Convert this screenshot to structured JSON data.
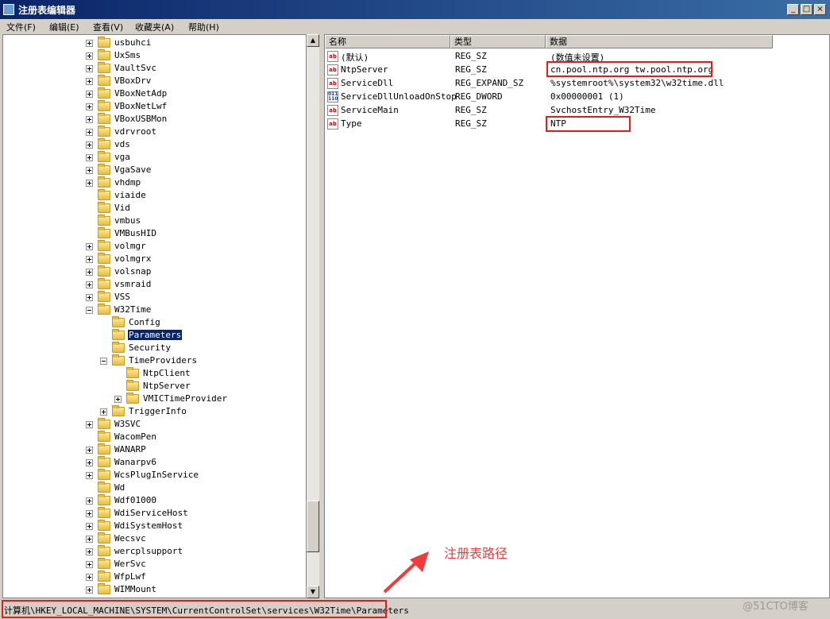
{
  "window": {
    "title": "注册表编辑器",
    "minimize": "_",
    "maximize": "□",
    "close": "×"
  },
  "menu": [
    "文件(F)",
    "编辑(E)",
    "查看(V)",
    "收藏夹(A)",
    "帮助(H)"
  ],
  "tree": {
    "nodes": [
      {
        "label": "usbuhci",
        "depth": 0,
        "expandable": true
      },
      {
        "label": "UxSms",
        "depth": 0,
        "expandable": true
      },
      {
        "label": "VaultSvc",
        "depth": 0,
        "expandable": true
      },
      {
        "label": "VBoxDrv",
        "depth": 0,
        "expandable": true
      },
      {
        "label": "VBoxNetAdp",
        "depth": 0,
        "expandable": true
      },
      {
        "label": "VBoxNetLwf",
        "depth": 0,
        "expandable": true
      },
      {
        "label": "VBoxUSBMon",
        "depth": 0,
        "expandable": true
      },
      {
        "label": "vdrvroot",
        "depth": 0,
        "expandable": true
      },
      {
        "label": "vds",
        "depth": 0,
        "expandable": true
      },
      {
        "label": "vga",
        "depth": 0,
        "expandable": true
      },
      {
        "label": "VgaSave",
        "depth": 0,
        "expandable": true
      },
      {
        "label": "vhdmp",
        "depth": 0,
        "expandable": true
      },
      {
        "label": "viaide",
        "depth": 0,
        "expandable": false
      },
      {
        "label": "Vid",
        "depth": 0,
        "expandable": false
      },
      {
        "label": "vmbus",
        "depth": 0,
        "expandable": false
      },
      {
        "label": "VMBusHID",
        "depth": 0,
        "expandable": false
      },
      {
        "label": "volmgr",
        "depth": 0,
        "expandable": true
      },
      {
        "label": "volmgrx",
        "depth": 0,
        "expandable": true
      },
      {
        "label": "volsnap",
        "depth": 0,
        "expandable": true
      },
      {
        "label": "vsmraid",
        "depth": 0,
        "expandable": true
      },
      {
        "label": "VSS",
        "depth": 0,
        "expandable": true
      },
      {
        "label": "W32Time",
        "depth": 0,
        "expandable": true,
        "expanded": true
      },
      {
        "label": "Config",
        "depth": 1,
        "expandable": false
      },
      {
        "label": "Parameters",
        "depth": 1,
        "expandable": false,
        "selected": true
      },
      {
        "label": "Security",
        "depth": 1,
        "expandable": false
      },
      {
        "label": "TimeProviders",
        "depth": 1,
        "expandable": true,
        "expanded": true
      },
      {
        "label": "NtpClient",
        "depth": 2,
        "expandable": false
      },
      {
        "label": "NtpServer",
        "depth": 2,
        "expandable": false
      },
      {
        "label": "VMICTimeProvider",
        "depth": 2,
        "expandable": true
      },
      {
        "label": "TriggerInfo",
        "depth": 1,
        "expandable": true
      },
      {
        "label": "W3SVC",
        "depth": 0,
        "expandable": true
      },
      {
        "label": "WacomPen",
        "depth": 0,
        "expandable": false
      },
      {
        "label": "WANARP",
        "depth": 0,
        "expandable": true
      },
      {
        "label": "Wanarpv6",
        "depth": 0,
        "expandable": true
      },
      {
        "label": "WcsPlugInService",
        "depth": 0,
        "expandable": true
      },
      {
        "label": "Wd",
        "depth": 0,
        "expandable": false
      },
      {
        "label": "Wdf01000",
        "depth": 0,
        "expandable": true
      },
      {
        "label": "WdiServiceHost",
        "depth": 0,
        "expandable": true
      },
      {
        "label": "WdiSystemHost",
        "depth": 0,
        "expandable": true
      },
      {
        "label": "Wecsvc",
        "depth": 0,
        "expandable": true
      },
      {
        "label": "wercplsupport",
        "depth": 0,
        "expandable": true
      },
      {
        "label": "WerSvc",
        "depth": 0,
        "expandable": true
      },
      {
        "label": "WfpLwf",
        "depth": 0,
        "expandable": true
      },
      {
        "label": "WIMMount",
        "depth": 0,
        "expandable": true
      }
    ]
  },
  "values": {
    "columns": [
      "名称",
      "类型",
      "数据"
    ],
    "rows": [
      {
        "name": "(默认)",
        "type": "REG_SZ",
        "data": "(数值未设置)",
        "icon": "string-value-icon"
      },
      {
        "name": "NtpServer",
        "type": "REG_SZ",
        "data": "cn.pool.ntp.org tw.pool.ntp.org",
        "icon": "string-value-icon",
        "highlight": true
      },
      {
        "name": "ServiceDll",
        "type": "REG_EXPAND_SZ",
        "data": "%systemroot%\\system32\\w32time.dll",
        "icon": "string-value-icon"
      },
      {
        "name": "ServiceDllUnloadOnStop",
        "type": "REG_DWORD",
        "data": "0x00000001 (1)",
        "icon": "dword-value-icon"
      },
      {
        "name": "ServiceMain",
        "type": "REG_SZ",
        "data": "SvchostEntry_W32Time",
        "icon": "string-value-icon"
      },
      {
        "name": "Type",
        "type": "REG_SZ",
        "data": "NTP",
        "icon": "string-value-icon",
        "highlight": true
      }
    ]
  },
  "status": {
    "path": "计算机\\HKEY_LOCAL_MACHINE\\SYSTEM\\CurrentControlSet\\services\\W32Time\\Parameters"
  },
  "annotation": {
    "text": "注册表路径",
    "color": "#ef3b3b"
  },
  "watermark": "@51CTO博客",
  "colors": {
    "highlight_border": "#e01c1c",
    "title_bar": "#0a246a",
    "selection": "#0a246a"
  }
}
